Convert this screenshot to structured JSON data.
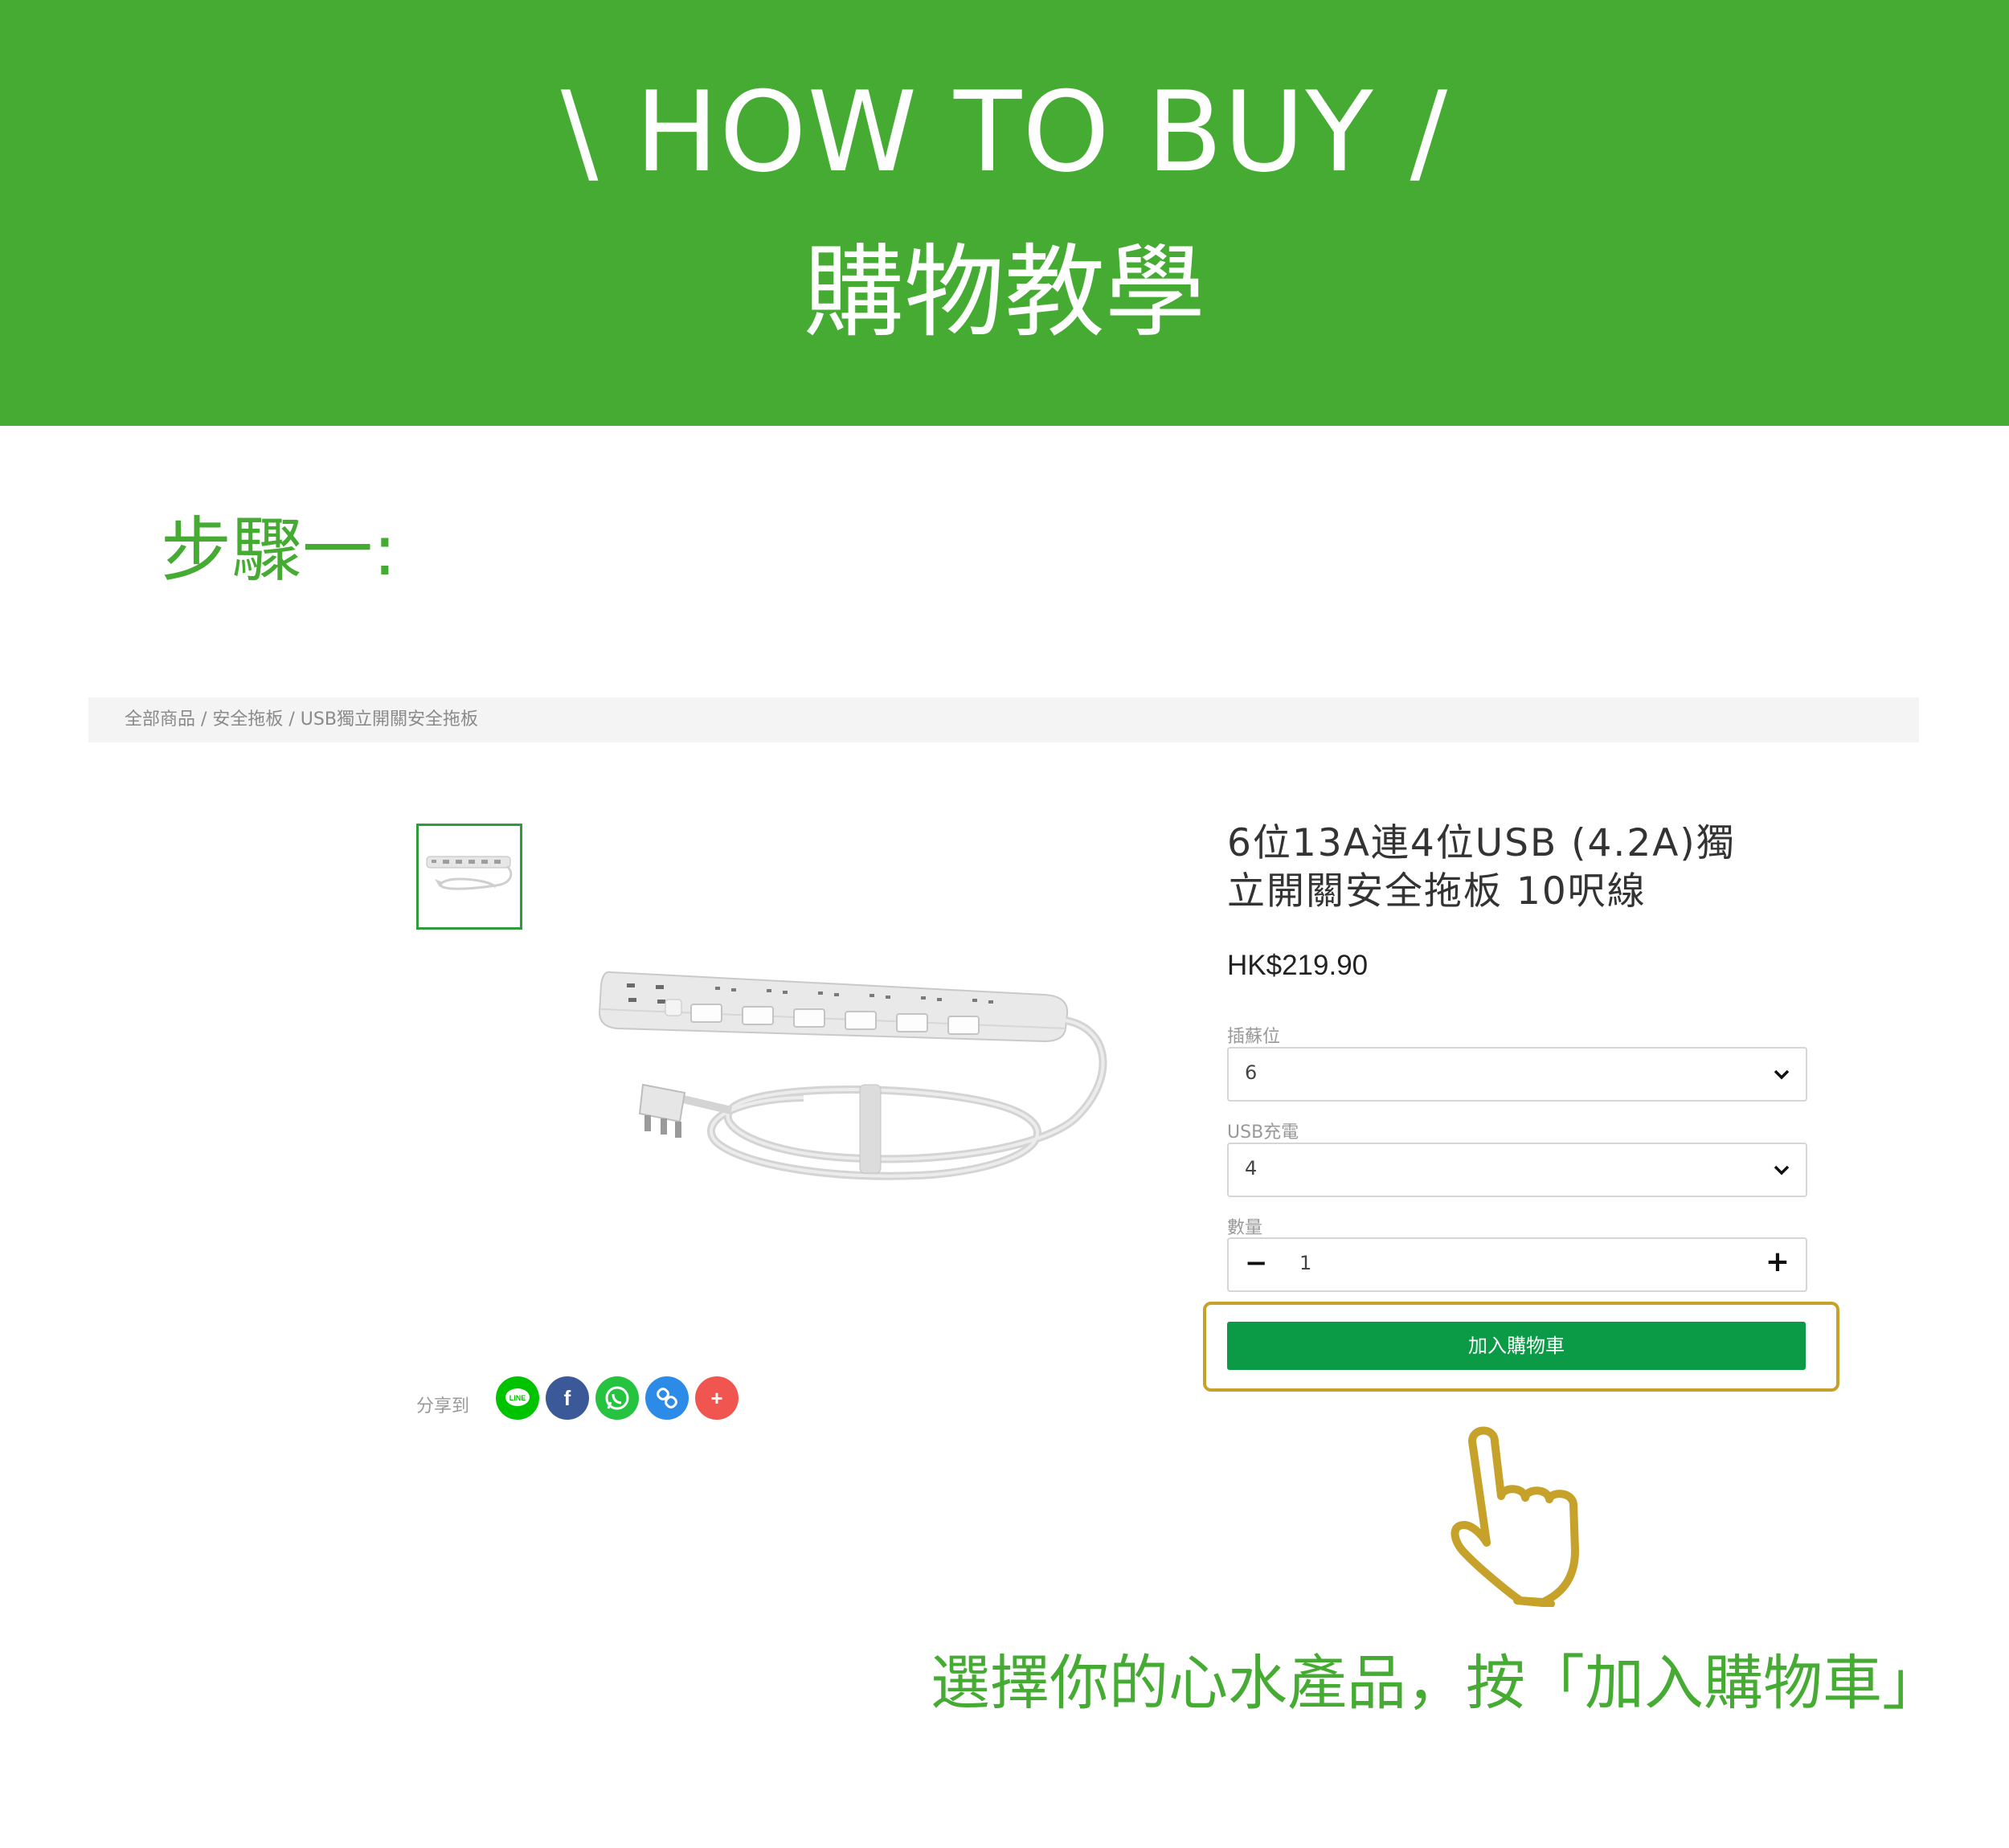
{
  "banner": {
    "title_en": "\\ HOW TO BUY /",
    "title_zh": "購物教學",
    "color": "#45ab33"
  },
  "step": {
    "label": "步驟一:"
  },
  "breadcrumb": "全部商品 / 安全拖板 / USB獨立開關安全拖板",
  "product": {
    "title_line1": "6位13A連4位USB (4.2A)獨",
    "title_line2": "立開關安全拖板 10呎線",
    "price": "HK$219.90"
  },
  "options": [
    {
      "label": "插蘇位",
      "value": "6"
    },
    {
      "label": "USB充電",
      "value": "4"
    }
  ],
  "quantity": {
    "label": "數量",
    "value": "1",
    "minus": "−",
    "plus": "+"
  },
  "add_to_cart": {
    "label": "加入購物車",
    "color": "#0b9a45",
    "highlight_color": "#c6a22a"
  },
  "share": {
    "label": "分享到",
    "icons": [
      {
        "name": "line-icon",
        "glyph": "LINE",
        "color": "#00c300"
      },
      {
        "name": "facebook-icon",
        "glyph": "f",
        "color": "#3b5998"
      },
      {
        "name": "whatsapp-icon",
        "glyph": "✆",
        "color": "#25c33f"
      },
      {
        "name": "copy-link-icon",
        "glyph": "🔗",
        "color": "#2b8be6"
      },
      {
        "name": "more-share-icon",
        "glyph": "+",
        "color": "#f0564f"
      }
    ]
  },
  "caption": "選擇你的心水產品，按「加入購物車」"
}
